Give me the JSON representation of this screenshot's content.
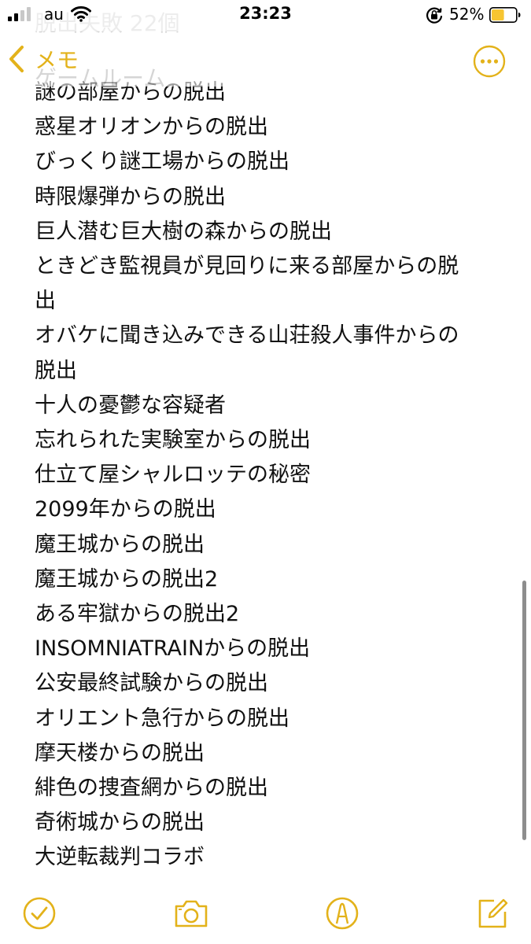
{
  "status_bar": {
    "carrier": "au",
    "time": "23:23",
    "battery_percent": "52%",
    "battery_level": 0.52,
    "signal_bars_active": 2,
    "signal_bars_total": 4
  },
  "nav": {
    "back_label": "メモ",
    "ghost_title_line_1": "脱出失敗 22個",
    "ghost_title_line_2": "ゲームルーム"
  },
  "note": {
    "lines": [
      "謎の部屋からの脱出",
      "惑星オリオンからの脱出",
      "びっくり謎工場からの脱出",
      "時限爆弾からの脱出",
      "巨人潜む巨大樹の森からの脱出",
      "ときどき監視員が見回りに来る部屋からの脱",
      "出",
      "オバケに聞き込みできる山荘殺人事件からの",
      "脱出",
      "十人の憂鬱な容疑者",
      "忘れられた実験室からの脱出",
      "仕立て屋シャルロッテの秘密",
      "2099年からの脱出",
      "魔王城からの脱出",
      "魔王城からの脱出2",
      "ある牢獄からの脱出2",
      "INSOMNIATRAINからの脱出",
      "公安最終試験からの脱出",
      "オリエント急行からの脱出",
      "摩天楼からの脱出",
      "緋色の捜査網からの脱出",
      "奇術城からの脱出",
      "大逆転裁判コラボ"
    ]
  },
  "toolbar": {
    "icons": [
      "checklist-icon",
      "camera-icon",
      "markup-icon",
      "compose-icon"
    ]
  },
  "colors": {
    "accent": "#E3B21A",
    "text": "#111111",
    "background": "#FFFFFF",
    "battery_fill": "#F7C531",
    "scrollbar": "#8D8D8D"
  }
}
